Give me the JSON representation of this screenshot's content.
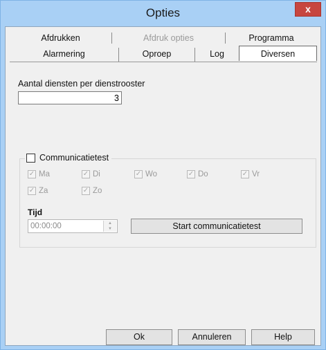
{
  "window": {
    "title": "Opties",
    "close_label": "x"
  },
  "tabs": {
    "row1": [
      {
        "label": "Afdrukken",
        "disabled": false
      },
      {
        "label": "Afdruk opties",
        "disabled": true
      },
      {
        "label": "Programma",
        "disabled": false
      }
    ],
    "row2": [
      {
        "label": "Alarmering"
      },
      {
        "label": "Oproep"
      },
      {
        "label": "Log"
      },
      {
        "label": "Diversen",
        "active": true
      }
    ]
  },
  "diversen": {
    "services_label": "Aantal diensten per dienstrooster",
    "services_value": "3",
    "commtest_label": "Communicatietest",
    "commtest_checked": false,
    "days": [
      {
        "label": "Ma",
        "checked": true
      },
      {
        "label": "Di",
        "checked": true
      },
      {
        "label": "Wo",
        "checked": true
      },
      {
        "label": "Do",
        "checked": true
      },
      {
        "label": "Vr",
        "checked": true
      },
      {
        "label": "Za",
        "checked": true
      },
      {
        "label": "Zo",
        "checked": true
      }
    ],
    "time_label": "Tijd",
    "time_value": "00:00:00",
    "start_button": "Start communicatietest"
  },
  "buttons": {
    "ok": "Ok",
    "cancel": "Annuleren",
    "help": "Help"
  }
}
